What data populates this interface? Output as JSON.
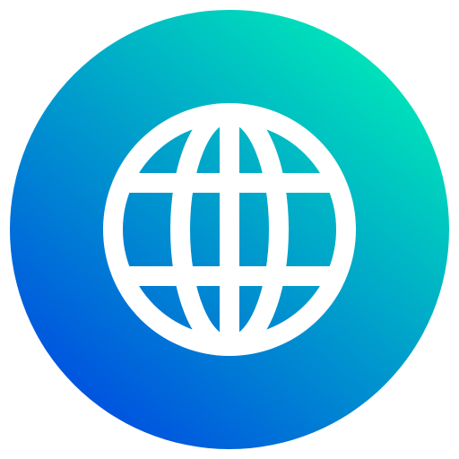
{
  "icon": {
    "name": "globe-icon",
    "gradient": {
      "start": "#0051e0",
      "end": "#00e8b8"
    },
    "stroke_color": "#ffffff",
    "background_color": "#ffffff"
  }
}
